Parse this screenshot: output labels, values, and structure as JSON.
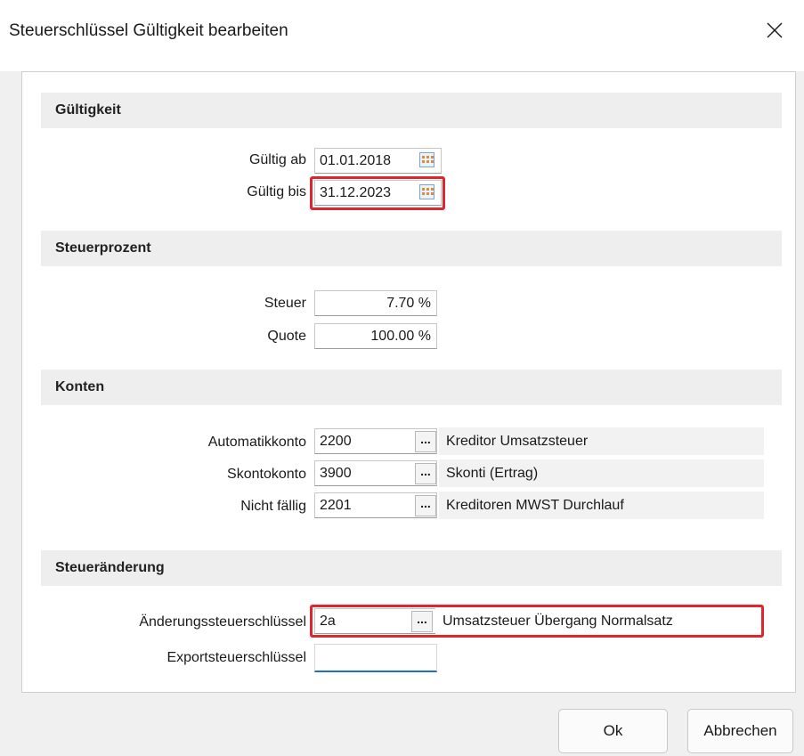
{
  "dialog": {
    "title": "Steuerschlüssel Gültigkeit bearbeiten",
    "close_icon": "close-icon"
  },
  "sections": {
    "gueltigkeit": {
      "header": "Gültigkeit",
      "gueltig_ab_label": "Gültig ab",
      "gueltig_ab_value": "01.01.2018",
      "gueltig_bis_label": "Gültig bis",
      "gueltig_bis_value": "31.12.2023"
    },
    "steuerprozent": {
      "header": "Steuerprozent",
      "steuer_label": "Steuer",
      "steuer_value": "7.70 %",
      "quote_label": "Quote",
      "quote_value": "100.00 %"
    },
    "konten": {
      "header": "Konten",
      "rows": [
        {
          "label": "Automatikkonto",
          "value": "2200",
          "button": "...",
          "description": "Kreditor Umsatzsteuer"
        },
        {
          "label": "Skontokonto",
          "value": "3900",
          "button": "...",
          "description": "Skonti (Ertrag)"
        },
        {
          "label": "Nicht fällig",
          "value": "2201",
          "button": "...",
          "description": "Kreditoren MWST Durchlauf"
        }
      ]
    },
    "steueraenderung": {
      "header": "Steueränderung",
      "aenderung_label": "Änderungssteuerschlüssel",
      "aenderung_value": "2a",
      "aenderung_button": "...",
      "aenderung_description": "Umsatzsteuer Übergang Normalsatz",
      "export_label": "Exportsteuerschlüssel",
      "export_value": ""
    }
  },
  "buttons": {
    "ok": "Ok",
    "cancel": "Abbrechen"
  },
  "colors": {
    "highlight": "#e0262c",
    "focus_underline": "#1f6fc4"
  }
}
